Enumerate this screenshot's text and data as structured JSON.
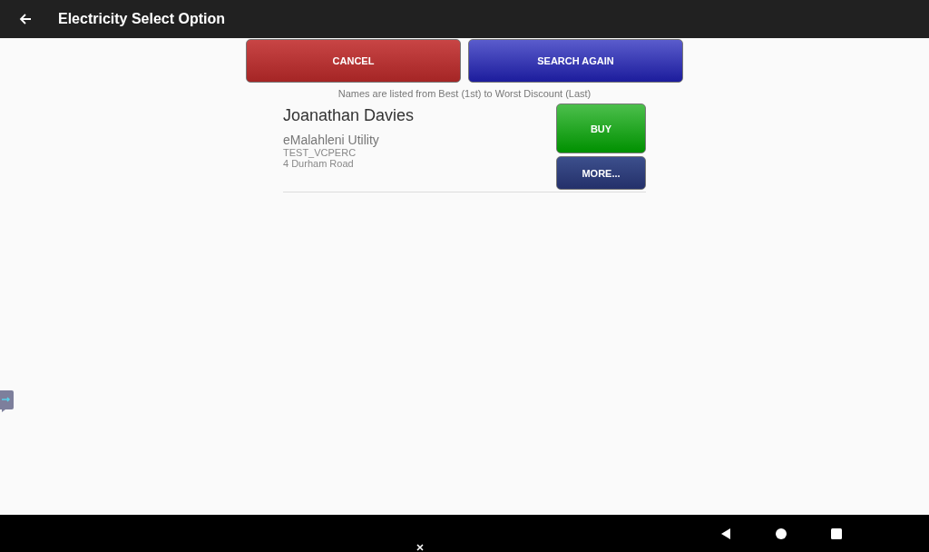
{
  "app_bar": {
    "title": "Electricity Select Option"
  },
  "actions": [
    {
      "label": "CANCEL",
      "kind": "cancel"
    },
    {
      "label": "SEARCH AGAIN",
      "kind": "search"
    }
  ],
  "hint": "Names are listed from Best (1st) to Worst Discount (Last)",
  "results": [
    {
      "name": "Joanathan Davies",
      "utility": "eMalahleni Utility",
      "code": "TEST_VCPERC",
      "address": "4 Durham Road",
      "buttons": [
        {
          "label": "BUY",
          "kind": "buy"
        },
        {
          "label": "MORE...",
          "kind": "more"
        }
      ]
    }
  ]
}
